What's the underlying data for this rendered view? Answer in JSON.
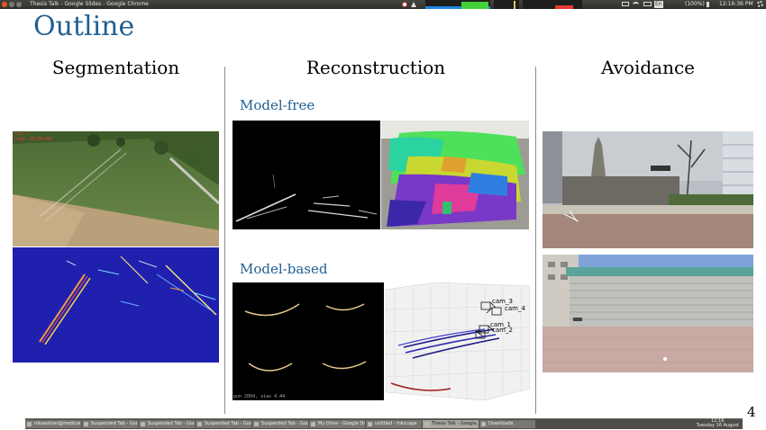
{
  "window": {
    "title": "Thesis Talk - Google Slides - Google Chrome"
  },
  "tray": {
    "keyboard": "En",
    "battery": "(100%)",
    "time": "12:16:36 PM",
    "icons": [
      "chrome-icon",
      "upload-arrow-icon",
      "cpu-graph",
      "network-graph",
      "mail-icon",
      "wifi-icon",
      "battery-icon",
      "keyboard-layout-icon",
      "volume-icon",
      "gear-icon"
    ],
    "colors": {
      "cpu": "#1e88e5",
      "network": "#43d13a",
      "disk": "#e53935",
      "accent": "#e95420"
    }
  },
  "slide": {
    "title": "Outline",
    "columns": {
      "segmentation": "Segmentation",
      "reconstruction": "Reconstruction",
      "avoidance": "Avoidance"
    },
    "subheads": {
      "model_free": "Model-free",
      "model_based": "Model-based"
    },
    "overlays": {
      "seg_caption_1": "frm: 3",
      "seg_caption_2": "time: 00:00:00",
      "depth_caption": "pun 2004, vias 4.44",
      "cam_labels": [
        "cam_3",
        "cam_4",
        "cam_1",
        "cam_2"
      ]
    },
    "page_number": "4",
    "colors": {
      "title": "#1f5f92",
      "divider": "#8c8c8c"
    }
  },
  "taskbar": {
    "tasks": [
      "mkaestner@medical...",
      "Suspended Tab - Goo...",
      "Suspended Tab - Goo...",
      "Suspended Tab - Goo...",
      "Suspended Tab - Goo...",
      "My Drive - Google Dr...",
      "untitled - Inkscape",
      "Thesis Talk - Google...",
      "Downloads"
    ],
    "clock_time": "12:16",
    "clock_date": "Tuesday 16 August"
  }
}
